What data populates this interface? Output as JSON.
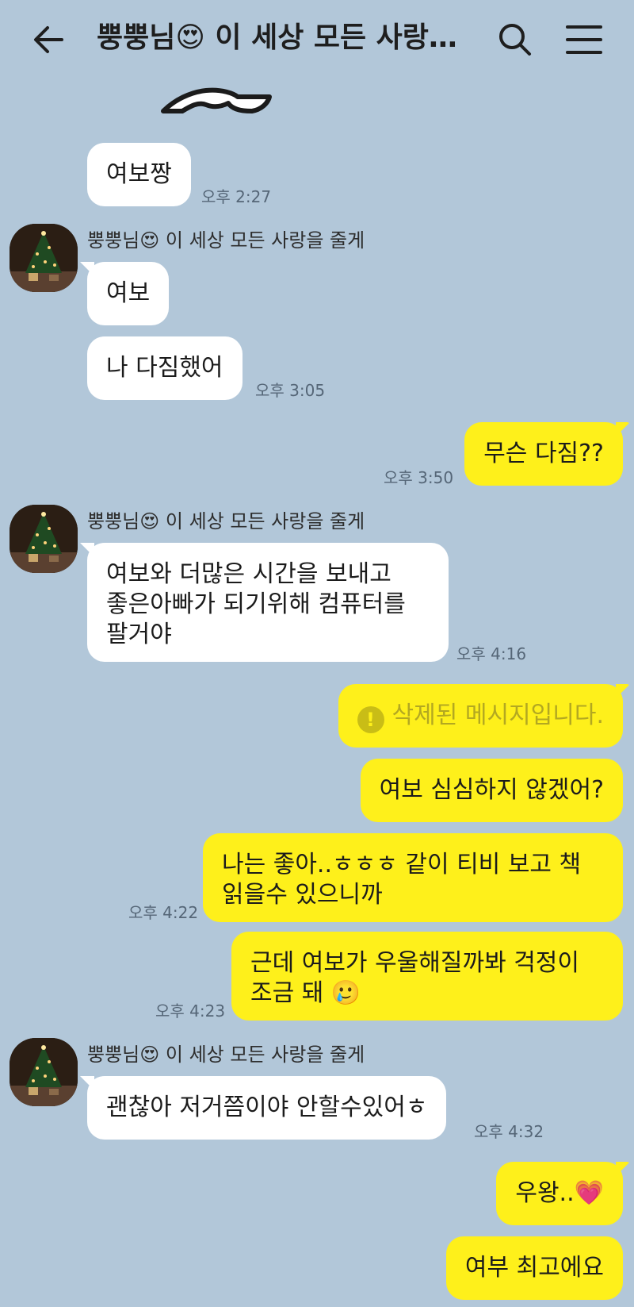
{
  "header": {
    "title": "뿡뿡님😍 이 세상 모든 사랑을 줄게",
    "back_icon": "arrow-left-icon",
    "search_icon": "search-icon",
    "menu_icon": "hamburger-menu-icon"
  },
  "sender_name": "뿡뿡님😍 이 세상 모든 사랑을 줄게",
  "messages": [
    {
      "from": "them",
      "text": "여보짱",
      "time": "오후 2:27"
    },
    {
      "from": "them",
      "text": "여보",
      "time": ""
    },
    {
      "from": "them",
      "text": "나 다짐했어",
      "time": "오후 3:05"
    },
    {
      "from": "me",
      "text": "무슨 다짐??",
      "time": "오후 3:50"
    },
    {
      "from": "them",
      "lines": [
        "여보와 더많은 시간을 보내고",
        "좋은아빠가 되기위해 컴퓨터를",
        "팔거야"
      ],
      "time": "오후 4:16"
    },
    {
      "from": "me",
      "text": "삭제된 메시지입니다.",
      "deleted": true,
      "time": ""
    },
    {
      "from": "me",
      "text": "여보 심심하지 않겠어?",
      "time": ""
    },
    {
      "from": "me",
      "lines": [
        "나는 좋아..ㅎㅎㅎ 같이 티비 보고 책",
        "읽을수 있으니까"
      ],
      "time": "오후 4:22"
    },
    {
      "from": "me",
      "lines": [
        "근데 여보가 우울해질까봐 걱정이",
        "조금 돼 🥲"
      ],
      "time": "오후 4:23"
    },
    {
      "from": "them",
      "text": "괜찮아 저거쯤이야 안할수있어ㅎ",
      "time": "오후 4:32"
    },
    {
      "from": "me",
      "text": "우왕..💗",
      "time": ""
    },
    {
      "from": "me",
      "text": "여부 최고에요",
      "time": ""
    }
  ],
  "colors": {
    "background": "#b2c7d9",
    "outgoing_bubble": "#fef01b",
    "incoming_bubble": "#ffffff",
    "time_text": "#556677"
  }
}
